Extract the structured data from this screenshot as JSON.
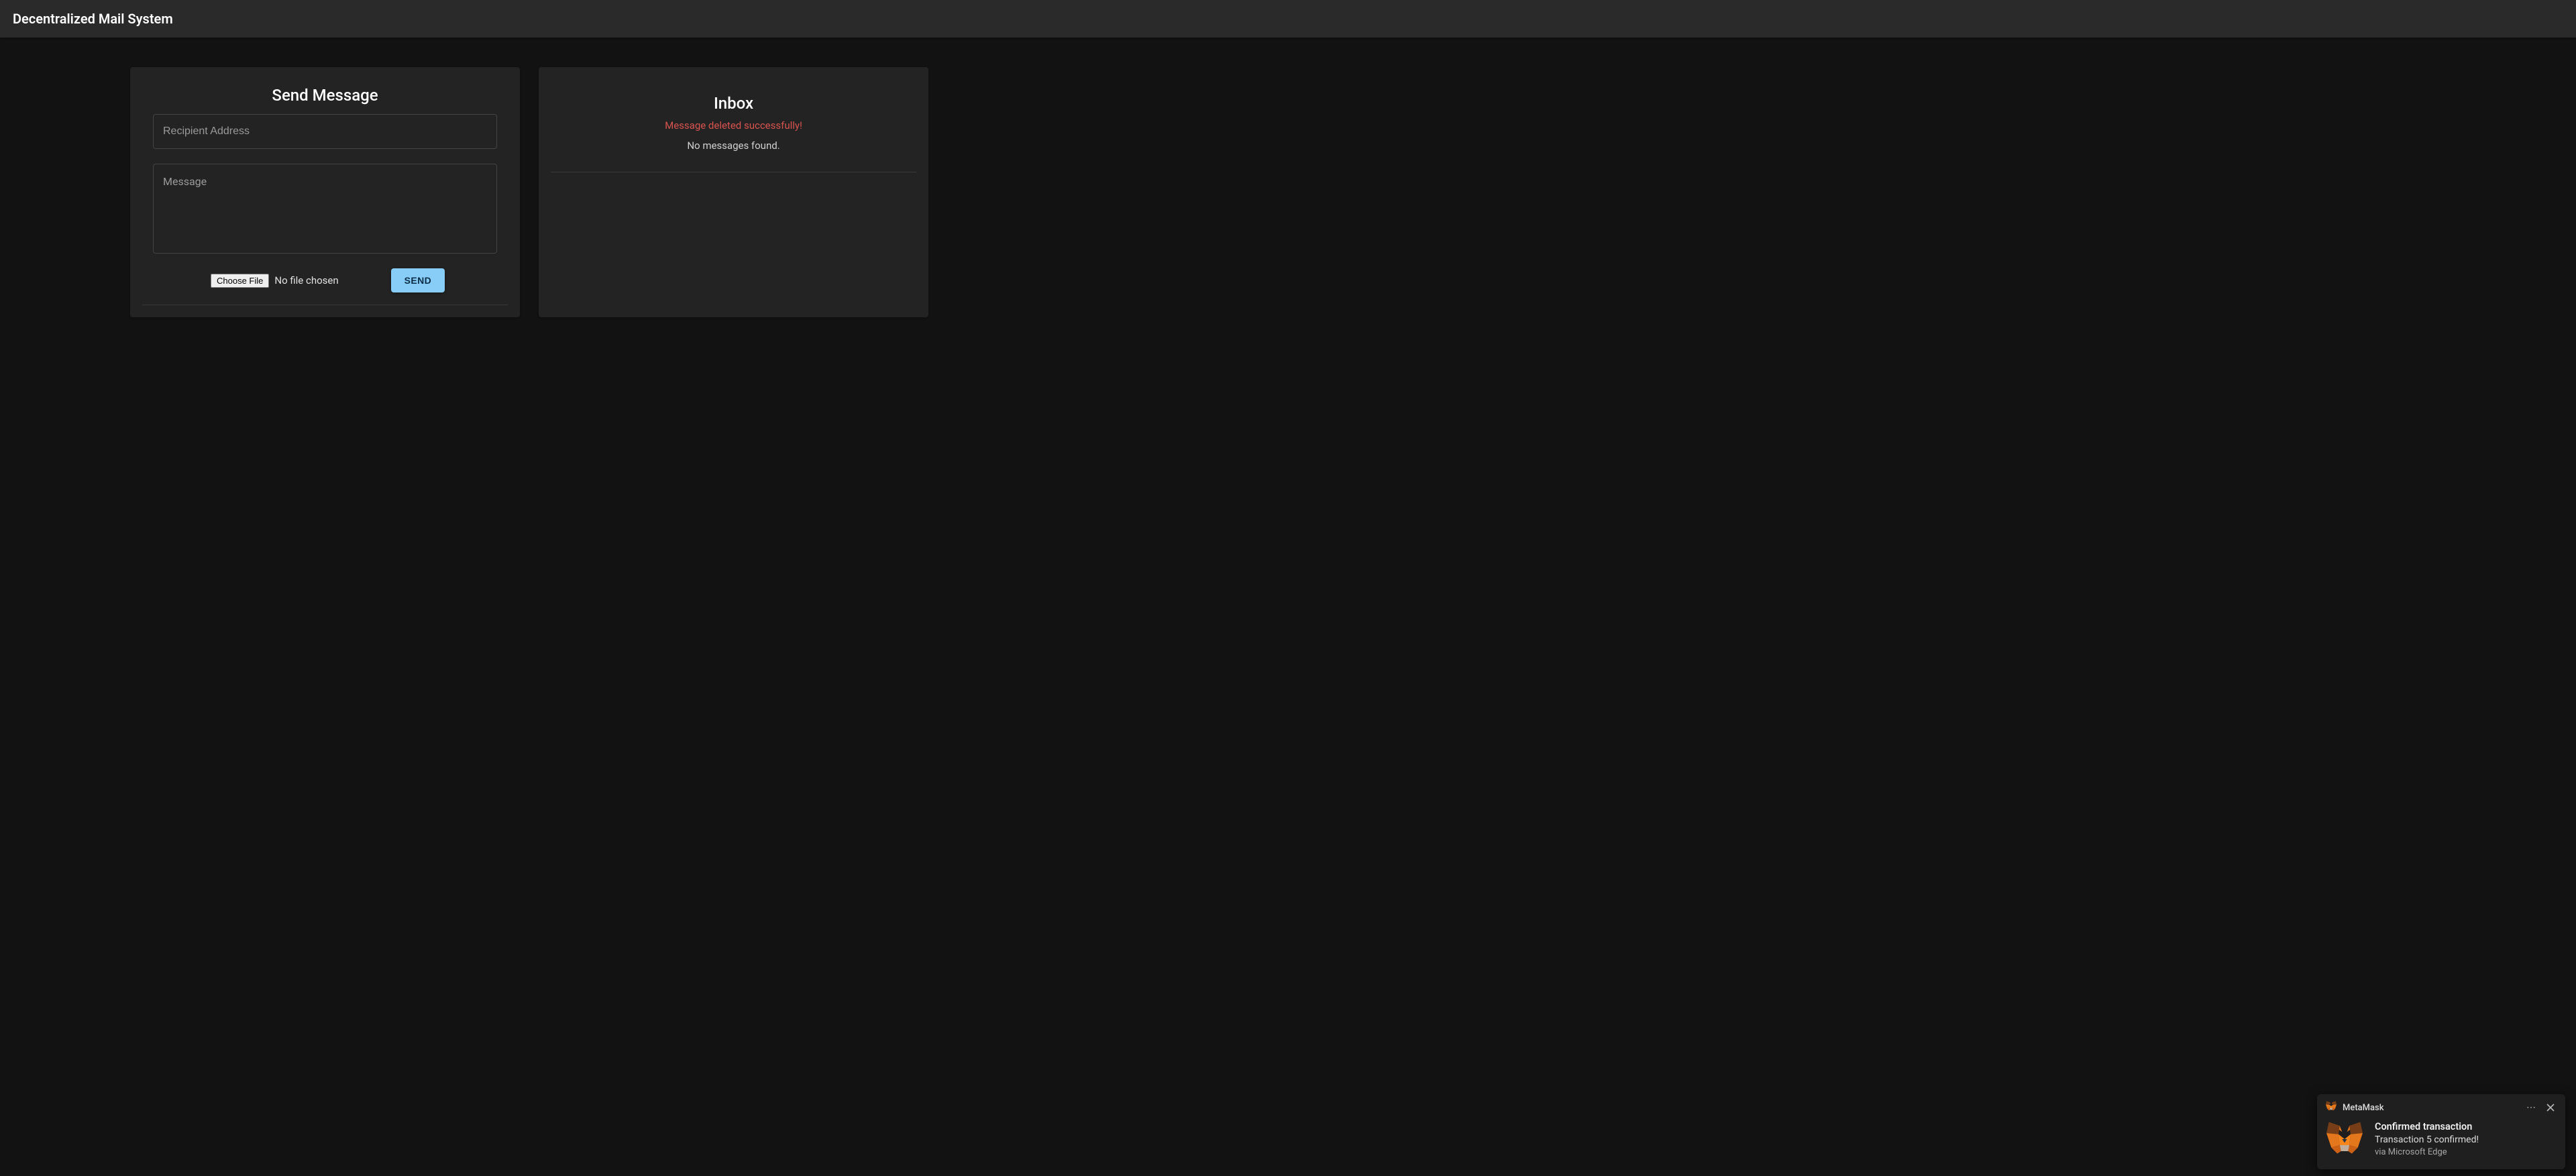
{
  "header": {
    "title": "Decentralized Mail System"
  },
  "send": {
    "title": "Send Message",
    "recipient_placeholder": "Recipient Address",
    "recipient_value": "",
    "message_placeholder": "Message",
    "message_value": "",
    "file_button_label": "Choose File",
    "file_status": "No file chosen",
    "send_button_label": "SEND"
  },
  "inbox": {
    "title": "Inbox",
    "status_message": "Message deleted successfully!",
    "empty_message": "No messages found."
  },
  "toast": {
    "app_name": "MetaMask",
    "heading": "Confirmed transaction",
    "detail": "Transaction 5 confirmed!",
    "via": "via Microsoft Edge"
  },
  "colors": {
    "accent": "#87cdf7",
    "error": "#d9534f"
  }
}
